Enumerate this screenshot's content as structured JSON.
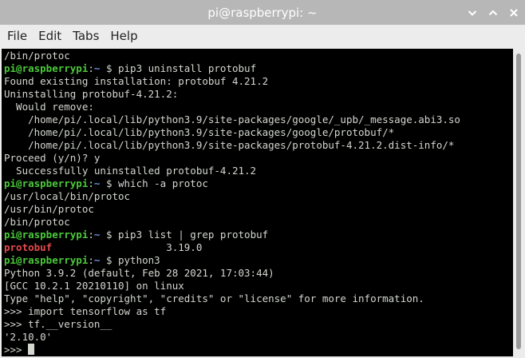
{
  "window": {
    "title": "pi@raspberrypi: ~",
    "controls": [
      "chevron-down-icon",
      "chevron-up-icon",
      "close-icon"
    ]
  },
  "menu": {
    "items": [
      "File",
      "Edit",
      "Tabs",
      "Help"
    ]
  },
  "colors": {
    "prompt_user": "#4bc93a",
    "prompt_path": "#6b8fd6",
    "grep_match": "#e34b4b",
    "text": "#d3d7cf",
    "background": "#000000"
  },
  "terminal": {
    "prompt": {
      "user_host": "pi@raspberrypi",
      "sep": ":",
      "path": "~",
      "symbol": "$ "
    },
    "lines": [
      {
        "type": "text",
        "text": "/bin/protoc"
      },
      {
        "type": "prompt",
        "command": "pip3 uninstall protobuf"
      },
      {
        "type": "text",
        "text": "Found existing installation: protobuf 4.21.2"
      },
      {
        "type": "text",
        "text": "Uninstalling protobuf-4.21.2:"
      },
      {
        "type": "text",
        "text": "  Would remove:"
      },
      {
        "type": "text",
        "text": "    /home/pi/.local/lib/python3.9/site-packages/google/_upb/_message.abi3.so"
      },
      {
        "type": "text",
        "text": "    /home/pi/.local/lib/python3.9/site-packages/google/protobuf/*"
      },
      {
        "type": "text",
        "text": "    /home/pi/.local/lib/python3.9/site-packages/protobuf-4.21.2.dist-info/*"
      },
      {
        "type": "text",
        "text": "Proceed (y/n)? y"
      },
      {
        "type": "text",
        "text": "  Successfully uninstalled protobuf-4.21.2"
      },
      {
        "type": "prompt",
        "command": "which -a protoc"
      },
      {
        "type": "text",
        "text": "/usr/local/bin/protoc"
      },
      {
        "type": "text",
        "text": "/usr/bin/protoc"
      },
      {
        "type": "text",
        "text": "/bin/protoc"
      },
      {
        "type": "prompt",
        "command": "pip3 list | grep protobuf"
      },
      {
        "type": "match",
        "match": "protobuf",
        "rest": "                   3.19.0"
      },
      {
        "type": "prompt",
        "command": "python3"
      },
      {
        "type": "text",
        "text": "Python 3.9.2 (default, Feb 28 2021, 17:03:44)"
      },
      {
        "type": "text",
        "text": "[GCC 10.2.1 20210110] on linux"
      },
      {
        "type": "text",
        "text": "Type \"help\", \"copyright\", \"credits\" or \"license\" for more information."
      },
      {
        "type": "text",
        "text": ">>> import tensorflow as tf"
      },
      {
        "type": "text",
        "text": ">>> tf.__version__"
      },
      {
        "type": "text",
        "text": "'2.10.0'"
      },
      {
        "type": "input",
        "text": ">>> "
      }
    ]
  }
}
